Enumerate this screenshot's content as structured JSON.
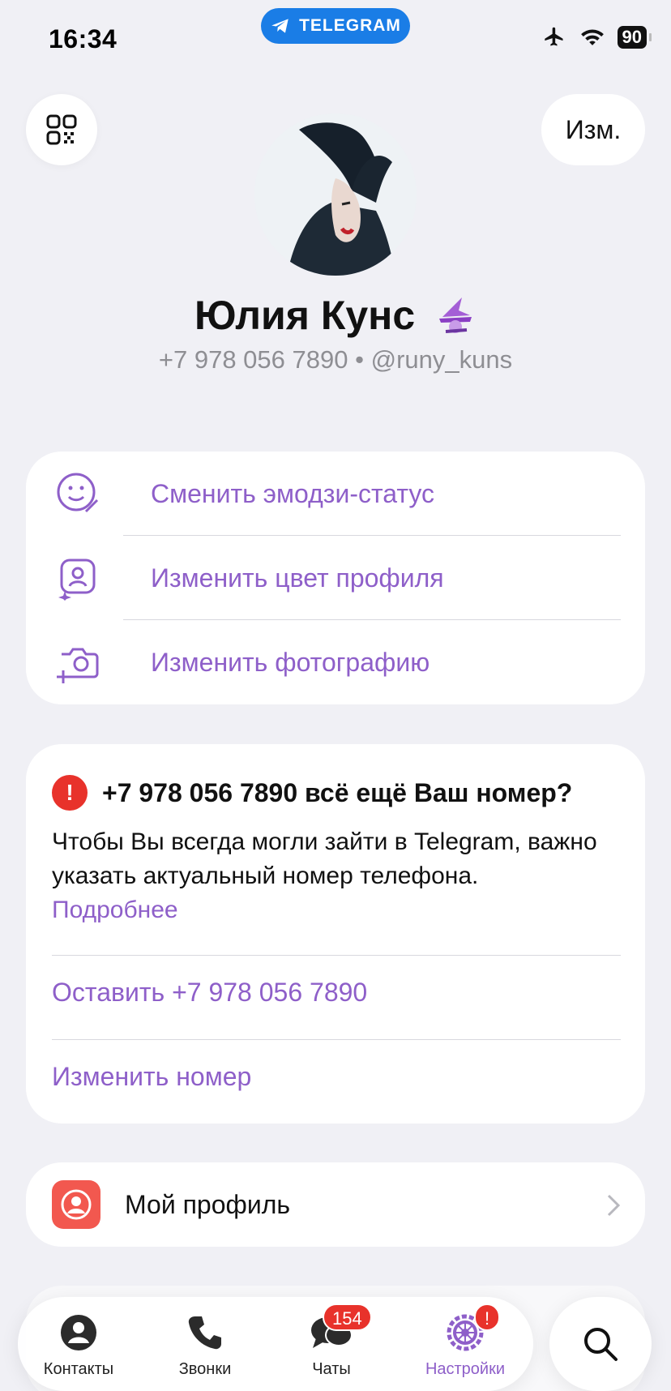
{
  "status_bar": {
    "time": "16:34",
    "app_pill": "TELEGRAM",
    "battery": "90",
    "icons": [
      "airplane-icon",
      "wifi-icon",
      "battery-icon"
    ]
  },
  "header": {
    "qr_icon": "qr-code-icon",
    "edit_label": "Изм."
  },
  "profile": {
    "name": "Юлия Кунс",
    "status_emoji": "witch-emoji",
    "phone": "+7 978 056 7890",
    "separator": "•",
    "username": "@runy_kuns"
  },
  "options": [
    {
      "label": "Сменить эмодзи-статус",
      "icon": "emoji-status-icon"
    },
    {
      "label": "Изменить цвет профиля",
      "icon": "profile-color-icon"
    },
    {
      "label": "Изменить фотографию",
      "icon": "camera-add-icon"
    }
  ],
  "phone_check": {
    "title": "+7 978 056 7890 всё ещё Ваш номер?",
    "body": "Чтобы Вы всегда могли зайти в Telegram, важно указать актуальный номер телефона.",
    "more_link": "Подробнее",
    "keep_action": "Оставить +7 978 056 7890",
    "change_action": "Изменить номер"
  },
  "my_profile": {
    "label": "Мой профиль",
    "icon": "person-icon"
  },
  "tabs": [
    {
      "label": "Контакты",
      "icon": "contacts-icon"
    },
    {
      "label": "Звонки",
      "icon": "phone-icon"
    },
    {
      "label": "Чаты",
      "icon": "chats-icon",
      "badge": "154"
    },
    {
      "label": "Настройки",
      "icon": "settings-icon",
      "badge": "!"
    }
  ],
  "colors": {
    "accent": "#8e5fc9",
    "telegram_blue": "#1a7de6",
    "alert_red": "#e8322b",
    "background": "#f0f0f5"
  }
}
